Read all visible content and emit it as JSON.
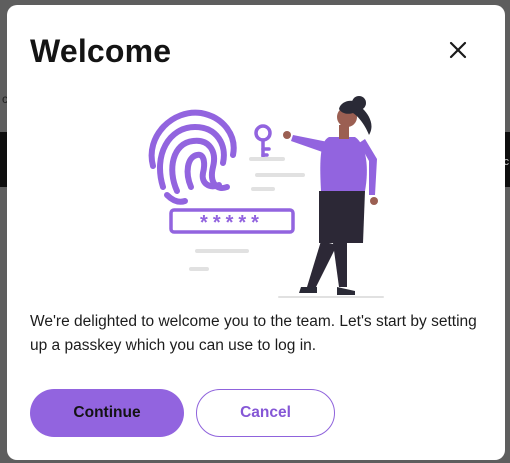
{
  "modal": {
    "title": "Welcome",
    "message": "We're delighted to welcome you to the team. Let's start by setting up a passkey which you can use to log in.",
    "continue_label": "Continue",
    "cancel_label": "Cancel",
    "password_mask": "*****"
  },
  "background": {
    "left_char": "c",
    "right_char": "c"
  },
  "icons": {
    "close": "close-icon",
    "illustration": "passkey-illustration"
  },
  "colors": {
    "accent": "#9264df",
    "accent_text": "#8557d6",
    "skin": "#9b5f52",
    "hair": "#2a2a36",
    "pants": "#2c2836",
    "line_gray": "#e1e1e1"
  }
}
